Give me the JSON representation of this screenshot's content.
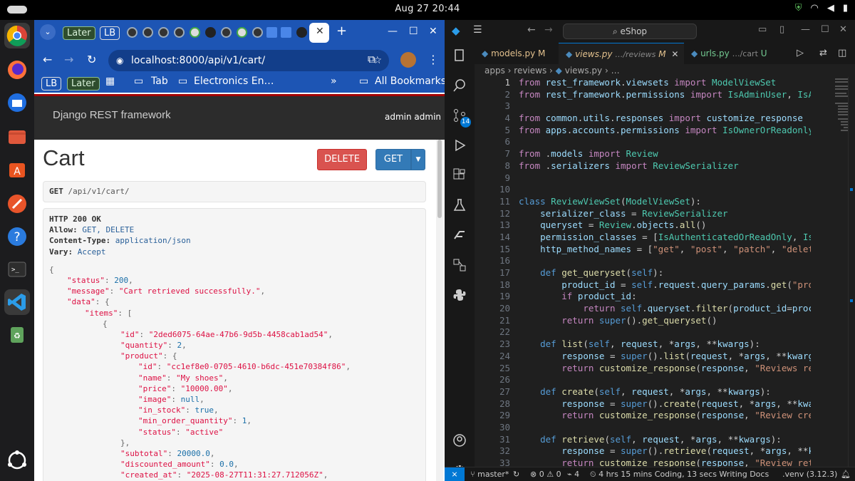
{
  "system": {
    "clock": "Aug 27  20:44"
  },
  "chrome": {
    "tab_groups": [
      "Later",
      "LB"
    ],
    "url": "localhost:8000/api/v1/cart/",
    "bookmarks": {
      "lb": "LB",
      "later": "Later",
      "tab": "Tab",
      "electronics": "Electronics En…",
      "more": "»",
      "all": "All Bookmarks"
    }
  },
  "drf": {
    "brand": "Django REST framework",
    "user": "admin admin",
    "page_title": "Cart",
    "delete_label": "DELETE",
    "get_label": "GET",
    "request_method": "GET",
    "request_path": "/api/v1/cart/",
    "status_line": "HTTP 200 OK",
    "headers": [
      {
        "name": "Allow:",
        "value": "GET, DELETE"
      },
      {
        "name": "Content-Type:",
        "value": "application/json"
      },
      {
        "name": "Vary:",
        "value": "Accept"
      }
    ],
    "json_lines": [
      {
        "indent": 0,
        "k": "",
        "v": "{",
        "t": "p"
      },
      {
        "indent": 1,
        "k": "\"status\"",
        "v": "200",
        "t": "n",
        "c": ","
      },
      {
        "indent": 1,
        "k": "\"message\"",
        "v": "\"Cart retrieved successfully.\"",
        "t": "s",
        "c": ","
      },
      {
        "indent": 1,
        "k": "\"data\"",
        "v": "{",
        "t": "p"
      },
      {
        "indent": 2,
        "k": "\"items\"",
        "v": "[",
        "t": "p"
      },
      {
        "indent": 3,
        "k": "",
        "v": "{",
        "t": "p"
      },
      {
        "indent": 4,
        "k": "\"id\"",
        "v": "\"2ded6075-64ae-47b6-9d5b-4458cab1ad54\"",
        "t": "s",
        "c": ","
      },
      {
        "indent": 4,
        "k": "\"quantity\"",
        "v": "2",
        "t": "n",
        "c": ","
      },
      {
        "indent": 4,
        "k": "\"product\"",
        "v": "{",
        "t": "p"
      },
      {
        "indent": 5,
        "k": "\"id\"",
        "v": "\"cc1ef8e0-0705-4610-b6dc-451e70384f86\"",
        "t": "s",
        "c": ","
      },
      {
        "indent": 5,
        "k": "\"name\"",
        "v": "\"My shoes\"",
        "t": "s",
        "c": ","
      },
      {
        "indent": 5,
        "k": "\"price\"",
        "v": "\"10000.00\"",
        "t": "s",
        "c": ","
      },
      {
        "indent": 5,
        "k": "\"image\"",
        "v": "null",
        "t": "n",
        "c": ","
      },
      {
        "indent": 5,
        "k": "\"in_stock\"",
        "v": "true",
        "t": "n",
        "c": ","
      },
      {
        "indent": 5,
        "k": "\"min_order_quantity\"",
        "v": "1",
        "t": "n",
        "c": ","
      },
      {
        "indent": 5,
        "k": "\"status\"",
        "v": "\"active\"",
        "t": "s",
        "c": ""
      },
      {
        "indent": 4,
        "k": "",
        "v": "},",
        "t": "p"
      },
      {
        "indent": 4,
        "k": "\"subtotal\"",
        "v": "20000.0",
        "t": "n",
        "c": ","
      },
      {
        "indent": 4,
        "k": "\"discounted_amount\"",
        "v": "0.0",
        "t": "n",
        "c": ","
      },
      {
        "indent": 4,
        "k": "\"created_at\"",
        "v": "\"2025-08-27T11:31:27.712056Z\"",
        "t": "s",
        "c": ","
      }
    ]
  },
  "vscode": {
    "search": "eShop",
    "tabs": [
      {
        "name": "models.py",
        "badge": "M",
        "path": ""
      },
      {
        "name": "views.py",
        "badge": "M",
        "path": "…/reviews"
      },
      {
        "name": "urls.py",
        "badge": "U",
        "path": "…/cart"
      }
    ],
    "breadcrumbs": [
      "apps",
      "reviews",
      "views.py",
      "…"
    ],
    "scm_badge": "14",
    "code": [
      "from rest_framework.viewsets import ModelViewSet",
      "from rest_framework.permissions import IsAdminUser, IsA",
      "",
      "from common.utils.responses import customize_response",
      "from apps.accounts.permissions import IsOwnerOrReadonly",
      "",
      "from .models import Review",
      "from .serializers import ReviewSerializer",
      "",
      "",
      "class ReviewViewSet(ModelViewSet):",
      "    serializer_class = ReviewSerializer",
      "    queryset = Review.objects.all()",
      "    permission_classes = [IsAuthenticatedOrReadOnly, Is",
      "    http_method_names = [\"get\", \"post\", \"patch\", \"delet",
      "",
      "    def get_queryset(self):",
      "        product_id = self.request.query_params.get(\"pro",
      "        if product_id:",
      "            return self.queryset.filter(product_id=proc",
      "        return super().get_queryset()",
      "",
      "    def list(self, request, *args, **kwargs):",
      "        response = super().list(request, *args, **kwarg",
      "        return customize_response(response, \"Reviews re",
      "",
      "    def create(self, request, *args, **kwargs):",
      "        response = super().create(request, *args, **kwa",
      "        return customize_response(response, \"Review cre",
      "",
      "    def retrieve(self, request, *args, **kwargs):",
      "        response = super().retrieve(request, *args, **k",
      "        return customize_response(response, \"Review ret"
    ],
    "status": {
      "branch": "master*",
      "problems": "⊗ 0 ⚠ 0",
      "ports": "4",
      "time": "4 hrs 15 mins Coding, 13 secs Writing Docs",
      "venv": ".venv (3.12.3)"
    }
  }
}
